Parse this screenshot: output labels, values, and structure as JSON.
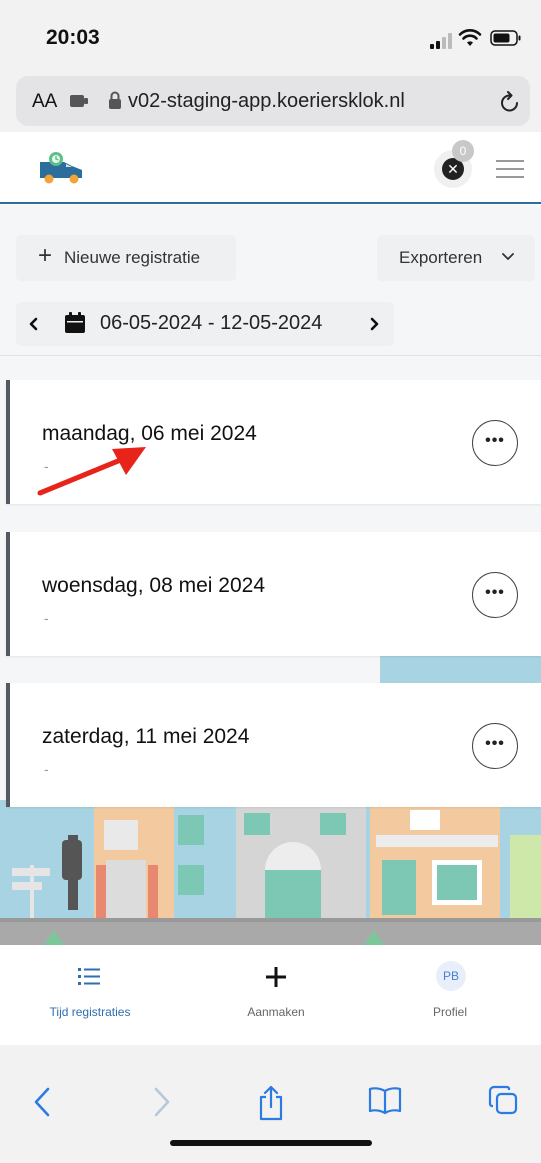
{
  "status_bar": {
    "time": "20:03"
  },
  "browser": {
    "text_size_label": "AA",
    "url": "v02-staging-app.koeriersklok.nl"
  },
  "header": {
    "notification_count": "0"
  },
  "toolbar": {
    "new_label": "Nieuwe registratie",
    "export_label": "Exporteren",
    "date_range": "06-05-2024 - 12-05-2024"
  },
  "entries": [
    {
      "day": "maandag, 06 mei 2024",
      "detail": "-"
    },
    {
      "day": "woensdag, 08 mei 2024",
      "detail": "-"
    },
    {
      "day": "zaterdag, 11 mei 2024",
      "detail": "-"
    }
  ],
  "nav": {
    "items": [
      {
        "label": "Tijd registraties",
        "icon": "list-icon",
        "active": true
      },
      {
        "label": "Aanmaken",
        "icon": "plus-icon",
        "active": false
      },
      {
        "label": "Profiel",
        "icon": "avatar",
        "initials": "PB",
        "active": false
      }
    ]
  },
  "colors": {
    "accent": "#2c6e9b",
    "active_nav": "#2d6fb0",
    "card_border": "#555a62",
    "annotation_arrow": "#e8231a"
  },
  "safari_toolbar": {
    "icons": [
      "back-icon",
      "forward-icon",
      "share-icon",
      "bookmarks-icon",
      "tabs-icon"
    ]
  }
}
